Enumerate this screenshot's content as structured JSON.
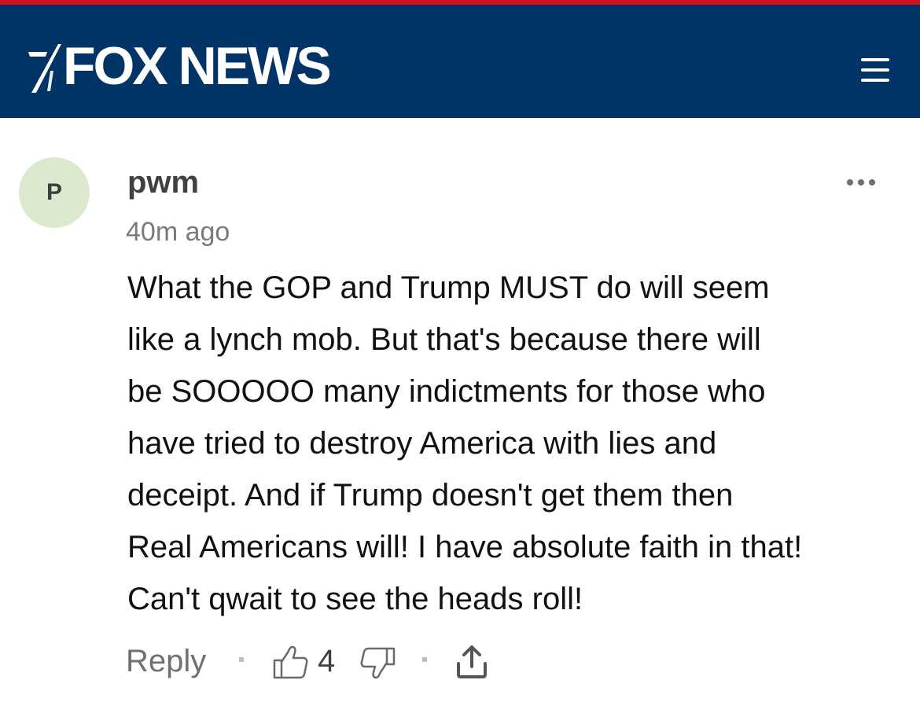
{
  "colors": {
    "brand_bar": "#003366",
    "top_stripe": "#d10f1f",
    "avatar_bg": "#dce9cf"
  },
  "header": {
    "logo_text": "FOX NEWS",
    "menu_icon": "hamburger-menu-icon"
  },
  "comment": {
    "avatar_initial": "P",
    "username": "pwm",
    "timestamp": "40m ago",
    "more_icon": "more-options-icon",
    "lines": [
      "What the GOP and Trump MUST do will seem",
      "like a lynch mob. But that's because there will",
      "be SOOOOO many indictments for those who",
      "have tried to destroy America with lies and",
      "deceipt. And if Trump doesn't get them then",
      "Real Americans will! I have absolute faith in that!",
      "Can't qwait to see the heads roll!"
    ],
    "actions": {
      "reply_label": "Reply",
      "like_count": "4",
      "like_icon": "thumbs-up-icon",
      "dislike_icon": "thumbs-down-icon",
      "share_icon": "share-icon"
    }
  }
}
